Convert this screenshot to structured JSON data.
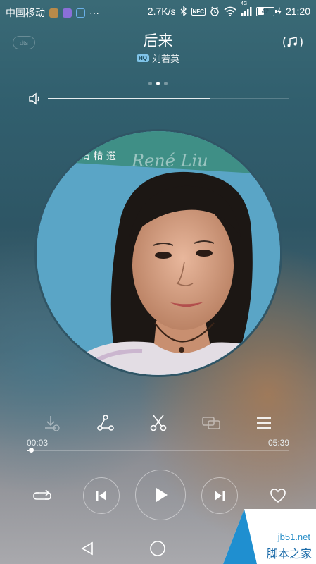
{
  "status_bar": {
    "carrier": "中国移动",
    "more": "···",
    "network_speed": "2.7K/s",
    "nfc": "NFC",
    "network_type": "4G",
    "battery": "42",
    "battery_level": 0.42,
    "time": "21:20"
  },
  "header": {
    "dts_label": "dts",
    "title": "后来",
    "quality_badge": "HQ",
    "artist": "刘若英",
    "page_count": 3,
    "active_page": 2
  },
  "volume": {
    "level": 0.67
  },
  "album": {
    "banner_text": "情 精 選",
    "banner_script": "René Liu"
  },
  "actions": {
    "items": [
      "download-icon",
      "share-icon",
      "cut-icon",
      "output-device-icon",
      "playlist-icon"
    ]
  },
  "progress": {
    "current_time": "00:03",
    "total_time": "05:39",
    "fraction": 0.009
  },
  "controls": {
    "items": [
      "repeat-icon",
      "previous-icon",
      "play-icon",
      "next-icon",
      "favorite-icon"
    ]
  },
  "watermark": {
    "site": "jb51.net",
    "name": "脚本之家"
  },
  "colors": {
    "accent": "#7fc3e8",
    "watermark_blue": "#2a8fc8"
  }
}
